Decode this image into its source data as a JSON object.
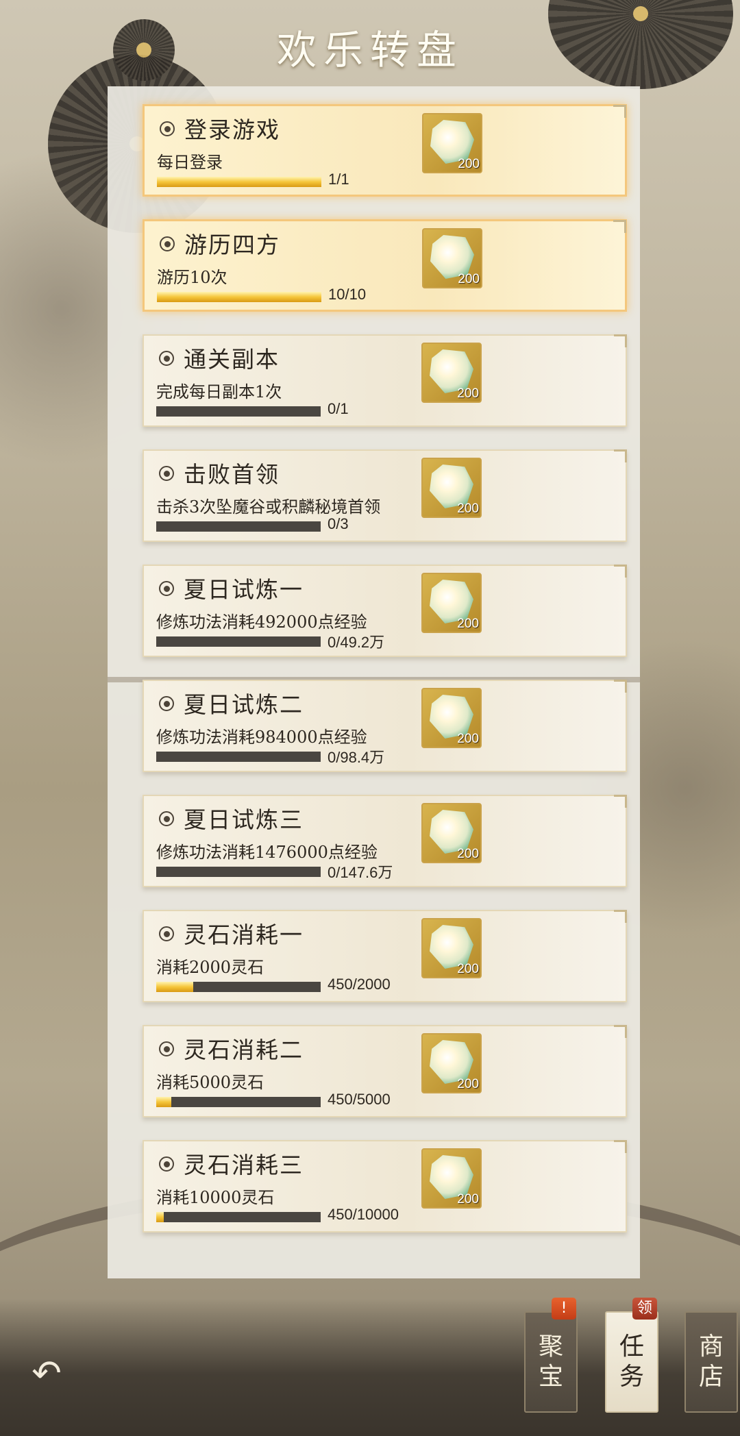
{
  "header": {
    "title": "欢乐转盘"
  },
  "tasks": [
    {
      "title": "登录游戏",
      "desc": "每日登录",
      "progress": "1/1",
      "fraction": 1.0,
      "reward": "200",
      "completed": true
    },
    {
      "title": "游历四方",
      "desc": "游历10次",
      "progress": "10/10",
      "fraction": 1.0,
      "reward": "200",
      "completed": true
    },
    {
      "title": "通关副本",
      "desc": "完成每日副本1次",
      "progress": "0/1",
      "fraction": 0.0,
      "reward": "200",
      "completed": false
    },
    {
      "title": "击败首领",
      "desc": "击杀3次坠魔谷或积麟秘境首领",
      "progress": "0/3",
      "fraction": 0.0,
      "reward": "200",
      "completed": false
    },
    {
      "title": "夏日试炼一",
      "desc": "修炼功法消耗492000点经验",
      "progress": "0/49.2万",
      "fraction": 0.0,
      "reward": "200",
      "completed": false
    },
    {
      "title": "夏日试炼二",
      "desc": "修炼功法消耗984000点经验",
      "progress": "0/98.4万",
      "fraction": 0.0,
      "reward": "200",
      "completed": false
    },
    {
      "title": "夏日试炼三",
      "desc": "修炼功法消耗1476000点经验",
      "progress": "0/147.6万",
      "fraction": 0.0,
      "reward": "200",
      "completed": false
    },
    {
      "title": "灵石消耗一",
      "desc": "消耗2000灵石",
      "progress": "450/2000",
      "fraction": 0.225,
      "reward": "200",
      "completed": false
    },
    {
      "title": "灵石消耗二",
      "desc": "消耗5000灵石",
      "progress": "450/5000",
      "fraction": 0.09,
      "reward": "200",
      "completed": false
    },
    {
      "title": "灵石消耗三",
      "desc": "消耗10000灵石",
      "progress": "450/10000",
      "fraction": 0.045,
      "reward": "200",
      "completed": false
    }
  ],
  "bottom_nav": {
    "back_icon": "back-arrow-icon",
    "treasure": {
      "line1": "聚",
      "line2": "宝",
      "badge": "!"
    },
    "tasks": {
      "line1": "任",
      "line2": "务",
      "badge": "领"
    },
    "shop": {
      "line1": "商",
      "line2": "店"
    }
  },
  "colors": {
    "progress_fill": "#f5c63b",
    "progress_track": "#4a4641",
    "done_border": "#f4c77c"
  }
}
